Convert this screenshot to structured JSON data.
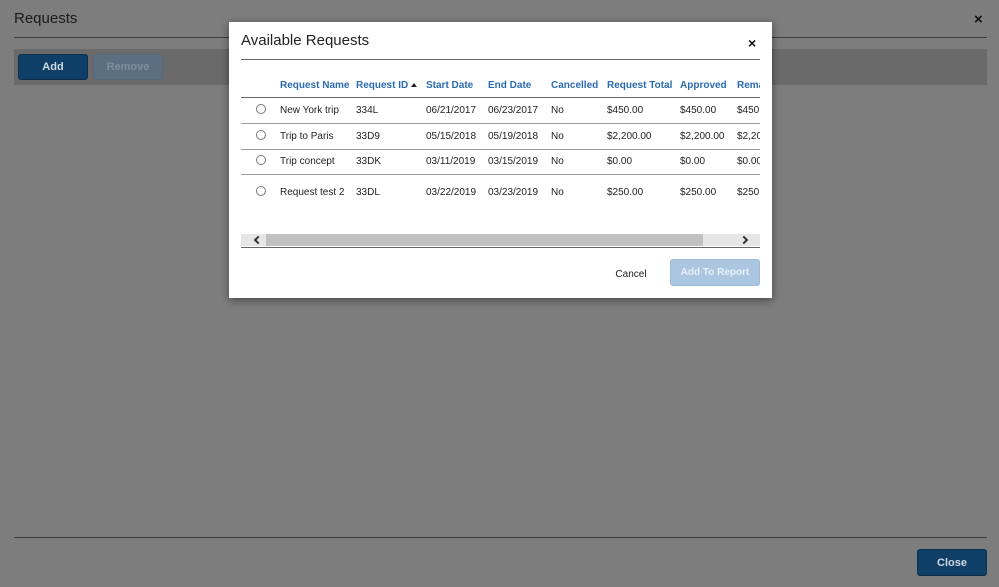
{
  "background": {
    "title": "Requests",
    "close_glyph": "×",
    "add_label": "Add",
    "remove_label": "Remove",
    "close_label": "Close"
  },
  "modal": {
    "title": "Available Requests",
    "close_glyph": "×",
    "columns": [
      "",
      "Request Name",
      "Request ID",
      "Start Date",
      "End Date",
      "Cancelled",
      "Request Total",
      "Approved",
      "Rema"
    ],
    "sorted_column": "Request ID",
    "sort_direction": "ascending",
    "rows": [
      {
        "name": "New York trip",
        "id": "334L",
        "start": "06/21/2017",
        "end": "06/23/2017",
        "cancelled": "No",
        "total": "$450.00",
        "approved": "$450.00",
        "remaining": "$450."
      },
      {
        "name": "Trip to Paris",
        "id": "33D9",
        "start": "05/15/2018",
        "end": "05/19/2018",
        "cancelled": "No",
        "total": "$2,200.00",
        "approved": "$2,200.00",
        "remaining": "$2,20"
      },
      {
        "name": "Trip concept",
        "id": "33DK",
        "start": "03/11/2019",
        "end": "03/15/2019",
        "cancelled": "No",
        "total": "$0.00",
        "approved": "$0.00",
        "remaining": "$0.00"
      },
      {
        "name": "Request test 2",
        "id": "33DL",
        "start": "03/22/2019",
        "end": "03/23/2019",
        "cancelled": "No",
        "total": "$250.00",
        "approved": "$250.00",
        "remaining": "$250."
      }
    ],
    "cancel_label": "Cancel",
    "add_to_report_label": "Add To Report"
  },
  "colors": {
    "header_text": "#2a6bb0",
    "primary_button": "#0f3e66",
    "disabled_button": "#aac6e0"
  }
}
